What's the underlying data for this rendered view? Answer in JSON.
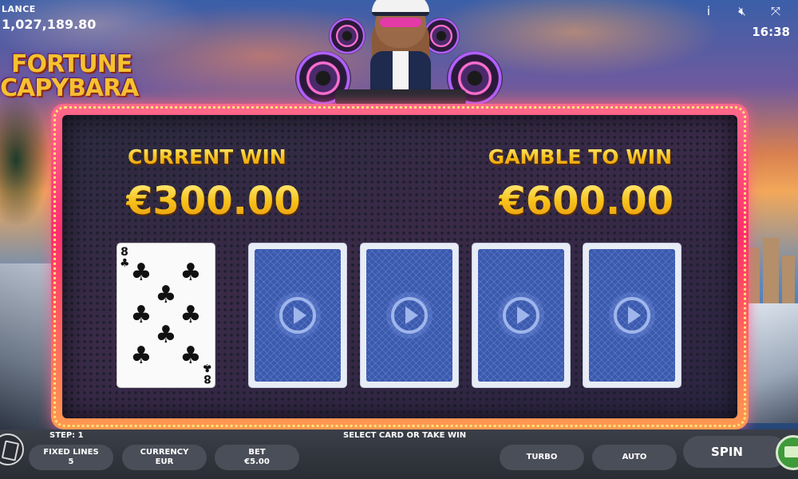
{
  "balance": {
    "label": "LANCE",
    "value": "1,027,189.80"
  },
  "hud": {
    "clock": "16:38",
    "icons": [
      "info-icon",
      "mute-icon",
      "fullscreen-icon"
    ]
  },
  "logo": {
    "line1": "FORTUNE",
    "line2": "CAPYBARA"
  },
  "gamble": {
    "current_win_label": "CURRENT WIN",
    "current_win_value": "€300.00",
    "gamble_label": "GAMBLE TO WIN",
    "gamble_value": "€600.00"
  },
  "cards": [
    {
      "state": "face",
      "rank": "8",
      "suit": "♣"
    },
    {
      "state": "back"
    },
    {
      "state": "back"
    },
    {
      "state": "back"
    },
    {
      "state": "back"
    }
  ],
  "bottom": {
    "step": "STEP: 1",
    "instruction": "SELECT CARD OR TAKE WIN",
    "fixed_lines_label": "FIXED LINES",
    "fixed_lines_value": "5",
    "currency_label": "CURRENCY",
    "currency_value": "EUR",
    "bet_label": "BET",
    "bet_value": "€5.00",
    "turbo_label": "TURBO",
    "auto_label": "AUTO",
    "spin_label": "SPIN"
  },
  "colors": {
    "gold": "#f7c21b",
    "frame": "#ff2e6e",
    "card_back": "#3a5ab0",
    "bar": "#2a2d34"
  }
}
